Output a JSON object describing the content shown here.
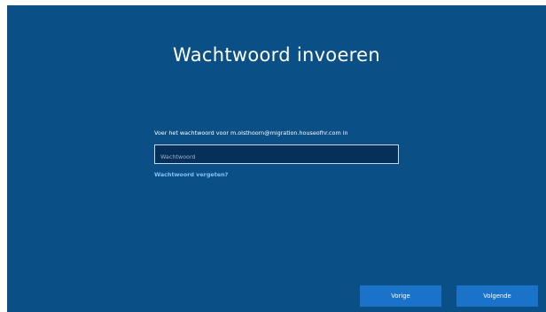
{
  "page": {
    "title": "Wachtwoord invoeren",
    "prompt": "Voer het wachtwoord voor m.olsthoorn@migration.houseofhr.com in"
  },
  "password_field": {
    "value": "",
    "placeholder": "Wachtwoord"
  },
  "links": {
    "forgot_password": "Wachtwoord vergeten?"
  },
  "buttons": {
    "back_label": "Vorige",
    "next_label": "Volgende"
  },
  "colors": {
    "background": "#0b4f87",
    "input_background": "#062f5a",
    "button": "#1b73c9",
    "link": "#7fc4f2"
  }
}
